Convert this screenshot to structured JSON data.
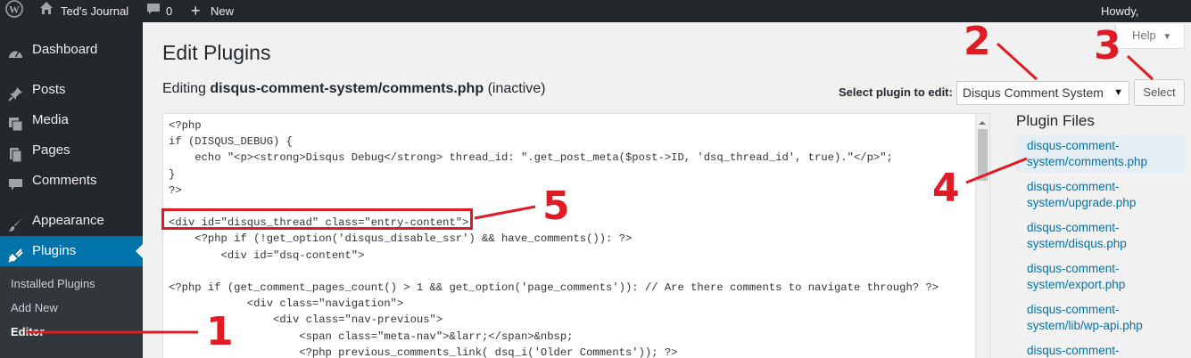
{
  "adminbar": {
    "site_name": "Ted's Journal",
    "comment_count": "0",
    "new_label": "New",
    "howdy": "Howdy,"
  },
  "sidebar": {
    "items": [
      {
        "label": "Dashboard",
        "icon": "dashboard-icon"
      },
      {
        "label": "Posts",
        "icon": "pin-icon"
      },
      {
        "label": "Media",
        "icon": "media-icon"
      },
      {
        "label": "Pages",
        "icon": "pages-icon"
      },
      {
        "label": "Comments",
        "icon": "comment-icon"
      },
      {
        "label": "Appearance",
        "icon": "brush-icon"
      },
      {
        "label": "Plugins",
        "icon": "plug-icon"
      }
    ],
    "submenu": [
      "Installed Plugins",
      "Add New",
      "Editor"
    ]
  },
  "main": {
    "title": "Edit Plugins",
    "editing_prefix": "Editing",
    "editing_file": "disqus-comment-system/comments.php",
    "editing_status": "(inactive)",
    "help_label": "Help",
    "select_label": "Select plugin to edit:",
    "selected_plugin": "Disqus Comment System",
    "select_button": "Select",
    "code": "<?php\nif (DISQUS_DEBUG) {\n    echo \"<p><strong>Disqus Debug</strong> thread_id: \".get_post_meta($post->ID, 'dsq_thread_id', true).\"</p>\";\n}\n?>\n\n<div id=\"disqus_thread\" class=\"entry-content\">\n    <?php if (!get_option('disqus_disable_ssr') && have_comments()): ?>\n        <div id=\"dsq-content\">\n\n<?php if (get_comment_pages_count() > 1 && get_option('page_comments')): // Are there comments to navigate through? ?>\n            <div class=\"navigation\">\n                <div class=\"nav-previous\">\n                    <span class=\"meta-nav\">&larr;</span>&nbsp;\n                    <?php previous_comments_link( dsq_i('Older Comments')); ?>"
  },
  "plugin_files": {
    "title": "Plugin Files",
    "files": [
      "disqus-comment-\nsystem/comments.php",
      "disqus-comment-\nsystem/upgrade.php",
      "disqus-comment-\nsystem/disqus.php",
      "disqus-comment-\nsystem/export.php",
      "disqus-comment-\nsystem/lib/wp-api.php",
      "disqus-comment-"
    ]
  },
  "annotations": {
    "labels": [
      "1",
      "2",
      "3",
      "4",
      "5"
    ],
    "color": "#e01b24"
  },
  "colors": {
    "adminbar": "#23282d",
    "active_menu": "#0073aa",
    "link": "#0073aa"
  }
}
